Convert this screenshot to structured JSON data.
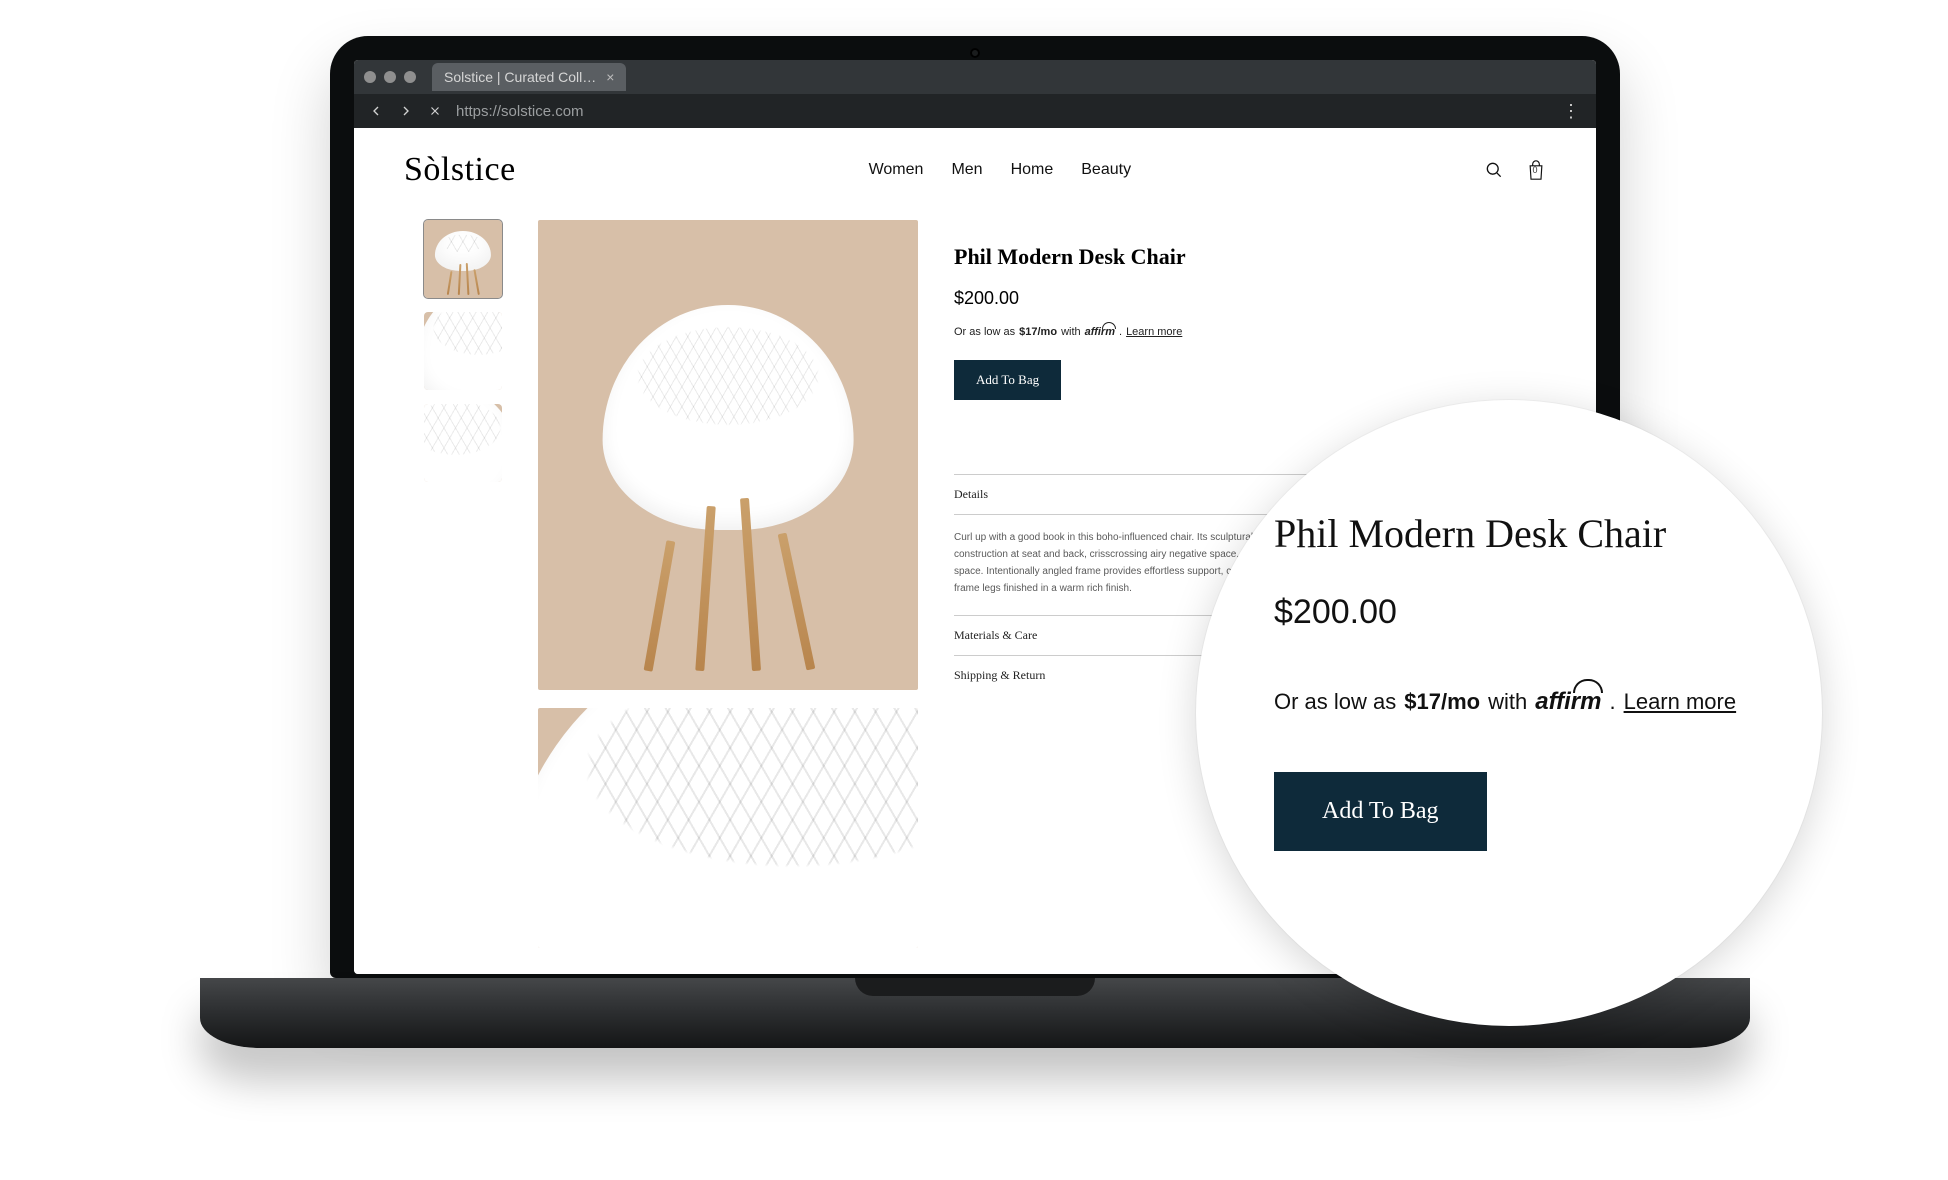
{
  "browser": {
    "tab_title": "Solstice | Curated Coll…",
    "url": "https://solstice.com"
  },
  "header": {
    "brand": "Sòlstice",
    "nav": [
      "Women",
      "Men",
      "Home",
      "Beauty"
    ],
    "bag_count": "0"
  },
  "product": {
    "title": "Phil Modern Desk Chair",
    "price": "$200.00",
    "affirm": {
      "prefix": "Or as low as",
      "amount": "$17/mo",
      "with": "with",
      "brand": "affirm",
      "learn": "Learn more"
    },
    "add_label": "Add To Bag",
    "details": {
      "heading": "Details",
      "body": "Curl up with a good book in this boho-influenced chair. Its sculptural lattice-weave shell construction at seat and back, crisscrossing airy negative space, adds texture + dimension to your space. Intentionally angled frame provides effortless support, constructed with mahogany wooden frame legs finished in a warm rich finish."
    },
    "materials_heading": "Materials & Care",
    "shipping_heading": "Shipping & Return"
  },
  "callout": {
    "title": "Phil Modern Desk Chair",
    "price": "$200.00",
    "affirm_prefix": "Or as low as",
    "affirm_amount": "$17/mo",
    "affirm_with": "with",
    "affirm_brand": "affirm",
    "affirm_learn": "Learn more",
    "add_label": "Add To Bag"
  },
  "colors": {
    "button_bg": "#0e2a3a",
    "image_bg": "#d7bfa8"
  }
}
